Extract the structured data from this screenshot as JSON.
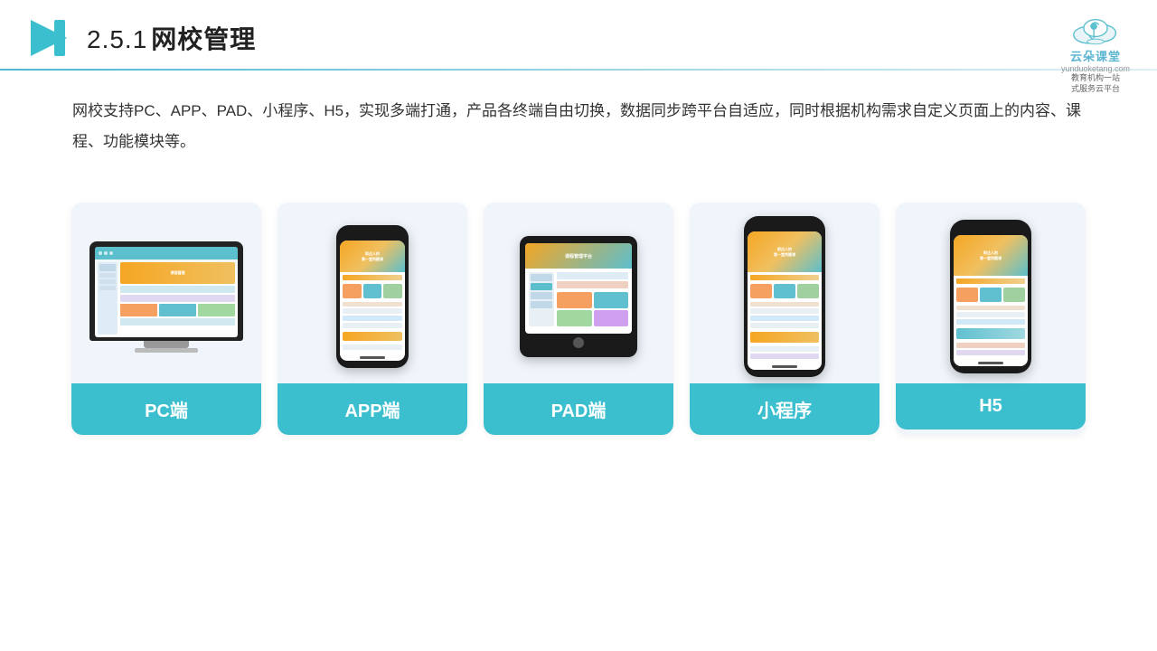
{
  "header": {
    "title": "2.5.1网校管理",
    "title_num": "2.5.1",
    "title_text": "网校管理",
    "brand_name": "云朵课堂",
    "brand_url": "yunduoketang.com",
    "brand_sub": "教育机构一站\n式服务云平台"
  },
  "description": {
    "text": "网校支持PC、APP、PAD、小程序、H5，实现多端打通，产品各终端自由切换，数据同步跨平台自适应，同时根据机构需求自定义页面上的内容、课程、功能模块等。"
  },
  "cards": [
    {
      "id": "pc",
      "label": "PC端"
    },
    {
      "id": "app",
      "label": "APP端"
    },
    {
      "id": "pad",
      "label": "PAD端"
    },
    {
      "id": "miniapp",
      "label": "小程序"
    },
    {
      "id": "h5",
      "label": "H5"
    }
  ]
}
